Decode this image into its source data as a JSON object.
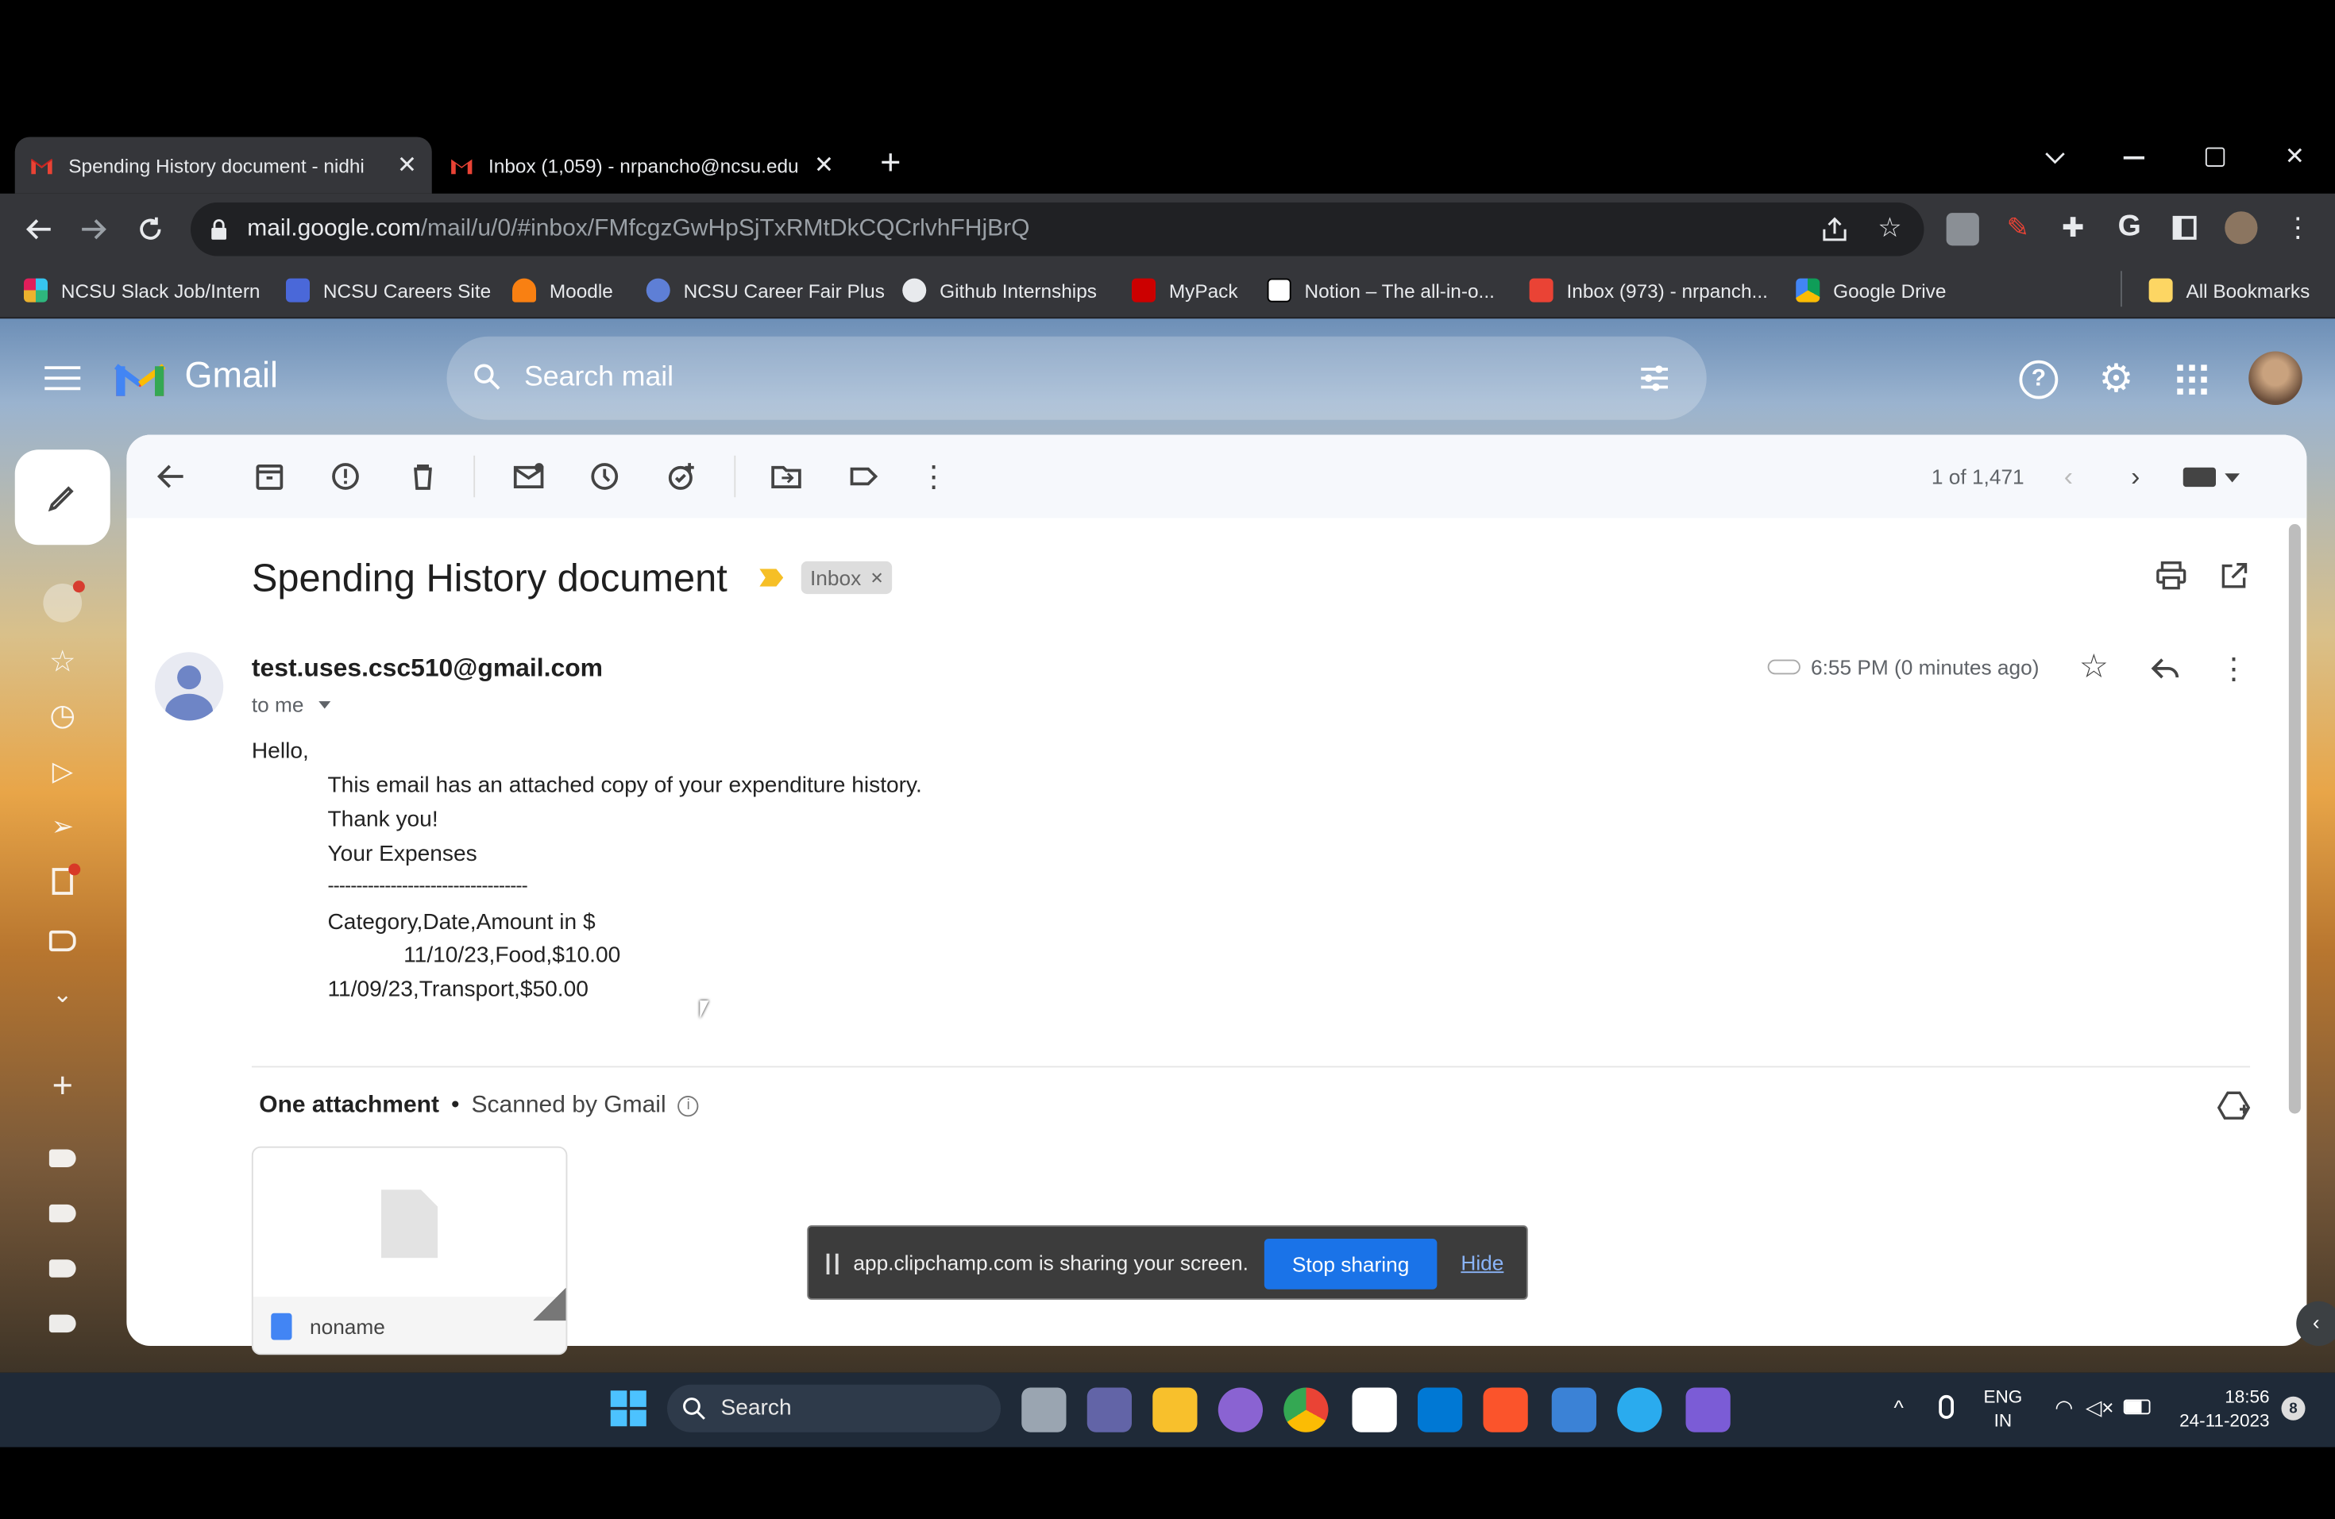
{
  "browser": {
    "tabs": [
      {
        "title": "Spending History document - nidhi",
        "active": true
      },
      {
        "title": "Inbox (1,059) - nrpancho@ncsu.edu",
        "active": false
      }
    ],
    "url_host": "mail.google.com",
    "url_path": "/mail/u/0/#inbox/FMfcgzGwHpSjTxRMtDkCQCrlvhFHjBrQ",
    "bookmarks": [
      "NCSU Slack Job/Intern",
      "NCSU Careers Site",
      "Moodle",
      "NCSU Career Fair Plus",
      "Github Internships",
      "MyPack",
      "Notion – The all-in-o...",
      "Inbox (973) - nrpanch...",
      "Google Drive"
    ],
    "all_bookmarks": "All Bookmarks"
  },
  "gmail": {
    "logo_text": "Gmail",
    "search_placeholder": "Search mail",
    "pagination": "1 of 1,471",
    "subject": "Spending History document",
    "label_chip": "Inbox",
    "sender": "test.uses.csc510@gmail.com",
    "recipient": "to me",
    "time": "6:55 PM (0 minutes ago)",
    "body": {
      "greeting": "Hello,",
      "line1": "This email has an attached copy of your expenditure history.",
      "line2": "Thank you!",
      "line3": "Your Expenses",
      "divider": "-----------------------------------",
      "header": "Category,Date,Amount in $",
      "row1": "11/10/23,Food,$10.00",
      "row2": "11/09/23,Transport,$50.00"
    },
    "attachment_title": "One attachment",
    "scanned": "Scanned by Gmail",
    "attachment_name": "noname"
  },
  "share_bar": {
    "message": "app.clipchamp.com is sharing your screen.",
    "stop": "Stop sharing",
    "hide": "Hide"
  },
  "taskbar": {
    "search": "Search",
    "lang1": "ENG",
    "lang2": "IN",
    "time": "18:56",
    "date": "24-11-2023",
    "notif_badge": "8"
  },
  "colors": {
    "accent_blue": "#1a73e8",
    "share_blue": "#1a73e8",
    "chrome_dark": "#35363a"
  }
}
